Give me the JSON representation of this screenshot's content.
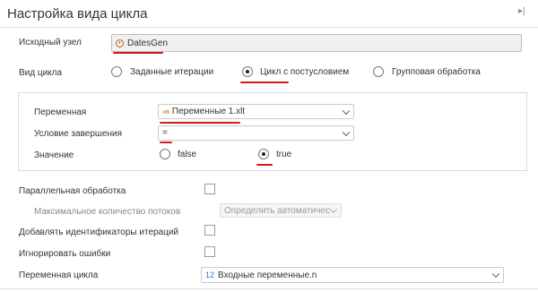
{
  "header": {
    "title": "Настройка вида цикла"
  },
  "source_node": {
    "label": "Исходный узел",
    "value": "DatesGen"
  },
  "cycle_type": {
    "label": "Вид цикла",
    "options": [
      {
        "label": "Заданные итерации",
        "checked": false
      },
      {
        "label": "Цикл с постусловием",
        "checked": true
      },
      {
        "label": "Групповая обработка",
        "checked": false
      }
    ]
  },
  "postcondition": {
    "variable_label": "Переменная",
    "variable_value": "Переменные 1.xlt",
    "variable_icon": "»a",
    "condition_label": "Условие завершения",
    "condition_value": "=",
    "value_label": "Значение",
    "value_options": [
      {
        "label": "false",
        "checked": false
      },
      {
        "label": "true",
        "checked": true
      }
    ]
  },
  "parallel": {
    "label": "Параллельная обработка",
    "max_threads_label": "Максимальное количество потоков",
    "max_threads_value": "Определить автоматически"
  },
  "add_ids": {
    "label": "Добавлять идентификаторы итераций"
  },
  "ignore_errors": {
    "label": "Игнорировать ошибки"
  },
  "loop_variable": {
    "label": "Переменная цикла",
    "value": "Входные переменные.n",
    "icon": "12"
  },
  "colors": {
    "annotation_red": "#d11a1a",
    "panel_border": "#d9d9d9"
  }
}
